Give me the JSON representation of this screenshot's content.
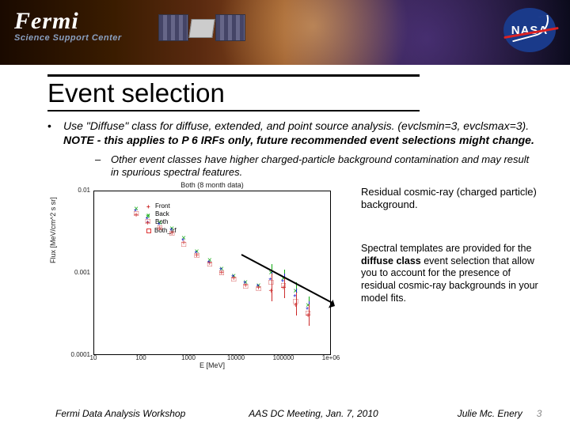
{
  "header": {
    "logo_main": "Fermi",
    "logo_sub": "Science Support Center",
    "nasa": "NASA"
  },
  "title": "Event selection",
  "bullet_main_pre": "Use \"Diffuse\" class for diffuse, extended, and point source analysis. (evclsmin=3, evclsmax=3). ",
  "bullet_main_bold": "NOTE - this applies to P 6 IRFs only, future recommended event selections might change.",
  "bullet_sub": "Other event classes have higher charged-particle background contamination and may result in spurious spectral features.",
  "caption1": "Residual cosmic-ray (charged particle) background.",
  "caption2_pre": "Spectral templates are provided for the ",
  "caption2_bold": "diffuse class",
  "caption2_post": " event selection that allow you to account for the presence of residual cosmic-ray backgrounds in your model fits.",
  "footer": {
    "left": "Fermi Data Analysis Workshop",
    "center": "AAS DC Meeting,  Jan. 7, 2010",
    "right": "Julie Mc. Enery",
    "page": "3"
  },
  "chart_data": {
    "type": "scatter",
    "title": "Both (8 month data)",
    "xlabel": "E [MeV]",
    "ylabel": "Flux [MeV/cm^2 s sr]",
    "x_log": true,
    "y_log": true,
    "xlim": [
      10,
      1000000
    ],
    "ylim": [
      0.0001,
      0.01
    ],
    "xticks": [
      10,
      100,
      1000,
      10000,
      100000,
      1000000
    ],
    "yticks": [
      0.0001,
      0.001,
      0.01
    ],
    "xtick_labels": [
      "10",
      "100",
      "1000",
      "10000",
      "100000",
      "1e+06"
    ],
    "ytick_labels": [
      "0.0001",
      "0.001",
      "0.01"
    ],
    "legend": [
      "Front",
      "Back",
      "Both",
      "Both_irf"
    ],
    "series": [
      {
        "name": "Front",
        "marker": "+",
        "color": "#c22",
        "x": [
          80,
          140,
          250,
          450,
          800,
          1500,
          2800,
          5000,
          9000,
          16000,
          30000,
          55000,
          100000,
          180000,
          330000
        ],
        "y": [
          0.005,
          0.004,
          0.0034,
          0.003,
          0.0023,
          0.0016,
          0.0013,
          0.001,
          0.00085,
          0.0007,
          0.00065,
          0.0006,
          0.00065,
          0.0004,
          0.0003
        ]
      },
      {
        "name": "Back",
        "marker": "x",
        "color": "#1a1",
        "x": [
          80,
          140,
          250,
          450,
          800,
          1500,
          2800,
          5000,
          9000,
          16000,
          30000,
          55000,
          100000,
          180000,
          330000
        ],
        "y": [
          0.006,
          0.0048,
          0.004,
          0.0034,
          0.0026,
          0.0018,
          0.0014,
          0.0011,
          0.0009,
          0.00075,
          0.0007,
          0.001,
          0.00085,
          0.0006,
          0.0004
        ]
      },
      {
        "name": "Both",
        "marker": "*",
        "color": "#22c",
        "x": [
          80,
          140,
          250,
          450,
          800,
          1500,
          2800,
          5000,
          9000,
          16000,
          30000,
          55000,
          100000,
          180000,
          330000
        ],
        "y": [
          0.0055,
          0.0044,
          0.0037,
          0.0032,
          0.0024,
          0.0017,
          0.0013,
          0.00105,
          0.00087,
          0.00072,
          0.00067,
          0.0008,
          0.00075,
          0.0005,
          0.00035
        ]
      },
      {
        "name": "Both_irf",
        "marker": "sq",
        "color": "#c33",
        "x": [
          80,
          140,
          250,
          450,
          800,
          1500,
          2800,
          5000,
          9000,
          16000,
          30000,
          55000,
          100000,
          180000,
          330000
        ],
        "y": [
          0.0052,
          0.0042,
          0.0035,
          0.003,
          0.0022,
          0.0016,
          0.00125,
          0.001,
          0.00082,
          0.00068,
          0.00063,
          0.00075,
          0.0007,
          0.00045,
          0.00032
        ]
      }
    ]
  }
}
